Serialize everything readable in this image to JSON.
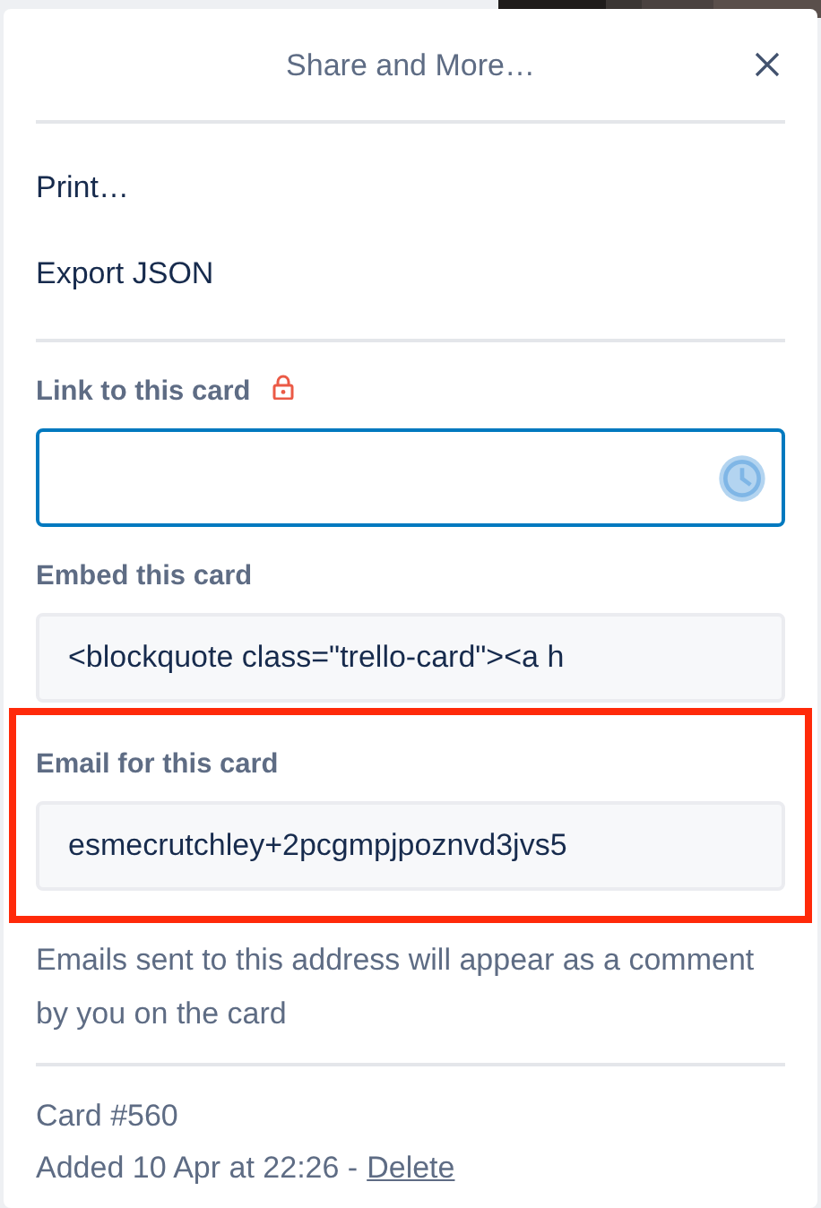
{
  "popover": {
    "title": "Share and More…"
  },
  "menu_items": [
    {
      "label": "Print…"
    },
    {
      "label": "Export JSON"
    }
  ],
  "fields": [
    {
      "label": "Link to this card",
      "locked": true,
      "focused": true,
      "highlighted": false
    },
    {
      "label": "Embed this card",
      "value": "<blockquote class=\"trello-card\"><a h",
      "locked": false,
      "focused": false,
      "highlighted": false
    },
    {
      "label": "Email for this card",
      "value": "esmecrutchley+2pcgmpjpoznvd3jvs5",
      "locked": false,
      "focused": false,
      "highlighted": true
    }
  ],
  "email_hint": "Emails sent to this address will appear as a comment by you on the card",
  "footer": {
    "card_number": "Card #560",
    "added": "Added 10 Apr at 22:26 -",
    "delete_link": "Delete"
  }
}
